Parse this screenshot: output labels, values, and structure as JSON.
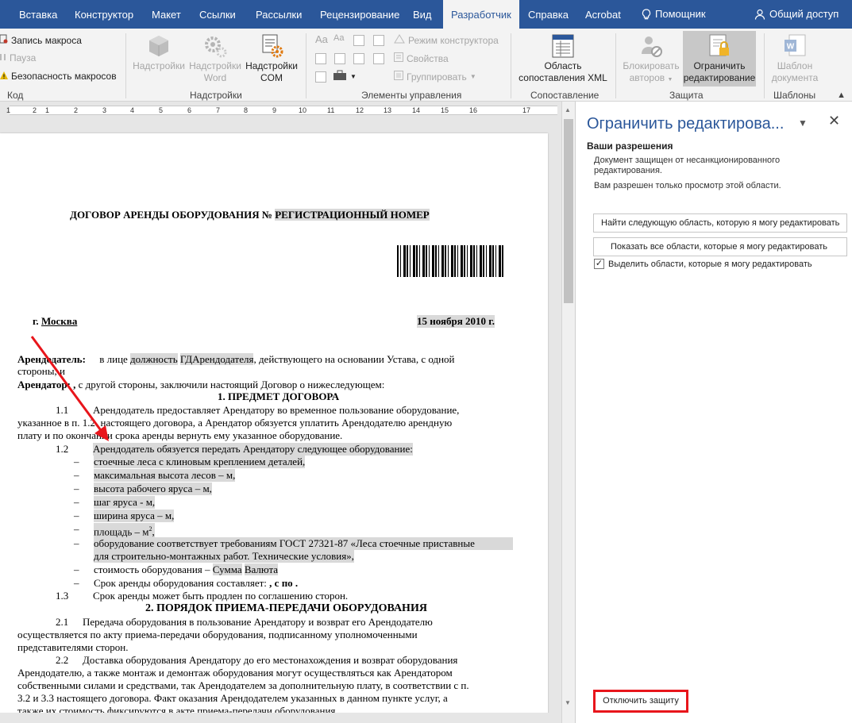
{
  "tabs": {
    "insert": "Вставка",
    "constructor": "Конструктор",
    "layout": "Макет",
    "references": "Ссылки",
    "mailings": "Рассылки",
    "review": "Рецензирование",
    "view": "Вид",
    "developer": "Разработчик",
    "help": "Справка",
    "acrobat": "Acrobat",
    "helper": "Помощник",
    "share": "Общий доступ"
  },
  "ribbon": {
    "code": {
      "record": "Запись макроса",
      "pause": "Пауза",
      "security": "Безопасность макросов",
      "label": "Код"
    },
    "addins": {
      "addins": [
        "Надстройки",
        ""
      ],
      "word_addins": [
        "Надстройки",
        "Word"
      ],
      "com_addins": [
        "Надстройки",
        "COM"
      ],
      "label": "Надстройки"
    },
    "controls": {
      "design_mode": "Режим конструктора",
      "properties": "Свойства",
      "group": "Группировать",
      "label": "Элементы управления"
    },
    "mapping": {
      "xml_pane": [
        "Область",
        "сопоставления XML"
      ],
      "label": "Сопоставление"
    },
    "protect": {
      "block_authors": [
        "Блокировать",
        "авторов"
      ],
      "restrict_editing": [
        "Ограничить",
        "редактирование"
      ],
      "label": "Защита"
    },
    "templates": {
      "doc_template": [
        "Шаблон",
        "документа"
      ],
      "label": "Шаблоны"
    }
  },
  "ruler": {
    "numbers": [
      "1",
      "2",
      "1",
      "2",
      "3",
      "4",
      "5",
      "6",
      "7",
      "8",
      "9",
      "10",
      "11",
      "12",
      "13",
      "14",
      "15",
      "16",
      "17"
    ]
  },
  "document": {
    "title_prefix": "ДОГОВОР АРЕНДЫ ОБОРУДОВАНИЯ № ",
    "title_field": "РЕГИСТРАЦИОННЫЙ НОМЕР",
    "city_prefix": "г. ",
    "city": "Москва",
    "date": "15 ноября 2010 г.",
    "lessor_label": "Арендодатель:",
    "lessor_text_1": "в лице ",
    "lessor_field_1": "должность",
    "lessor_field_2": "ГДАрендодателя",
    "lessor_text_2": ", действующего на основании Устава, с одной",
    "lessor_text_3": "стороны, и",
    "lessee_label": "Арендатор:",
    "lessee_comma": " ,",
    "lessee_text": " с другой стороны, заключили настоящий Договор о нижеследующем:",
    "sec1_title": "1.    ПРЕДМЕТ ДОГОВОРА",
    "p1_1_num": "1.1",
    "p1_1_l1": "Арендодатель предоставляет Арендатору во временное пользование оборудование,",
    "p1_1_l2": "указанное в п. 1.2. настоящего договора, а Арендатор обязуется уплатить Арендодателю арендную",
    "p1_1_l3": "плату и по окончании срока аренды вернуть ему указанное оборудование.",
    "p1_2_num": "1.2",
    "p1_2_text": "Арендодатель обязуется передать Арендатору следующее оборудование:",
    "items": [
      "стоечные леса с клиновым креплением деталей,",
      "максимальная высота лесов – м,",
      "высота рабочего яруса – м,",
      "шаг яруса - м,",
      "ширина яруса –  м,",
      "площадь –  м"
    ],
    "item_area_sup": "2",
    "item_area_tail": ",",
    "item_gost_1": "оборудование соответствует требованиям ГОСТ 27321-87 «Леса стоечные приставные",
    "item_gost_2": "для строительно-монтажных работ. Технические условия»,",
    "item_cost_text": "стоимость оборудования – ",
    "item_cost_f1": "Сумма",
    "item_cost_f2": "Валюта",
    "item_term_text": "Срок аренды оборудования  составляет: ",
    "item_term_tail": " ,   с  по  .",
    "dash": "–",
    "p1_3_num": "1.3",
    "p1_3_text": "Срок аренды может быть продлен по соглашению сторон.",
    "sec2_title": "2.  ПОРЯДОК ПРИЕМА-ПЕРЕДАЧИ ОБОРУДОВАНИЯ",
    "p2_1_num": "2.1",
    "p2_1_l1": "Передача оборудования в пользование Арендатору и возврат его Арендодателю",
    "p2_1_l2": "осуществляется по акту приема-передачи оборудования, подписанному уполномоченными",
    "p2_1_l3": "представителями сторон.",
    "p2_2_num": "2.2",
    "p2_2_l1": "Доставка оборудования Арендатору  до его местонахождения  и возврат оборудования",
    "p2_2_l2": "Арендодателю, а также  монтаж и демонтаж оборудования могут осуществляться как Арендатором",
    "p2_2_l3": "собственными силами и средствами, так Арендодателем за дополнительную плату, в соответствии с п.",
    "p2_2_l4": "3.2 и 3.3 настоящего договора. Факт оказания Арендодателем указанных в данном пункте услуг, а",
    "p2_2_l5": "также их стоимость фиксируются в акте приема-передачи оборудования."
  },
  "pane": {
    "title": "Ограничить редактирова...",
    "permissions_heading": "Ваши разрешения",
    "desc_1": "Документ защищен от несанкционированного",
    "desc_2": "редактирования.",
    "desc_3": "Вам разрешен только просмотр этой области.",
    "find_next_button": "Найти следующую область, которую я могу редактировать",
    "show_all_button": "Показать все области, которые я могу редактировать",
    "highlight_checkbox": "Выделить области, которые я могу редактировать",
    "highlight_checked": true,
    "stop_protection_button": "Отключить защиту"
  },
  "colors": {
    "accent": "#2b579a",
    "highlight_field": "#d9d9d9",
    "annotation_red": "#e8151b"
  }
}
